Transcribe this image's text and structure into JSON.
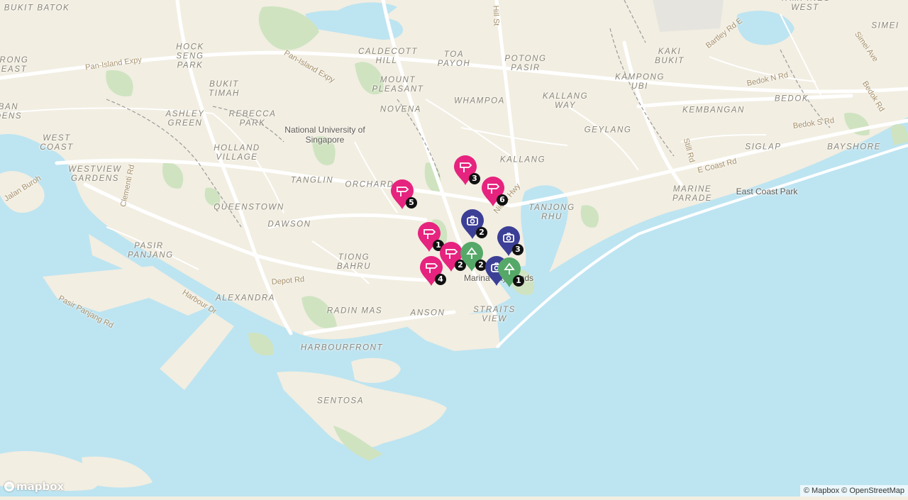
{
  "colors": {
    "water": "#bde4f1",
    "land": "#f2eee2",
    "park": "#cfe3c0",
    "sight": "#e6237e",
    "photo": "#3c3f96",
    "nature": "#55a868"
  },
  "areas": [
    "BUKIT BATOK",
    "HOCK SENG PARK",
    "CALDECOTT HILL",
    "TOA PAYOH",
    "POTONG PASIR",
    "KAKI BUKIT",
    "TAMPINES WEST",
    "SIMEI",
    "BUKIT TIMAH",
    "MOUNT PLEASANT",
    "KAMPONG UBI",
    "RONG EAST",
    "BAN DENS",
    "ASHLEY GREEN",
    "REBECCA PARK",
    "NOVENA",
    "WHAMPOA",
    "KALLANG WAY",
    "GEYLANG",
    "KEMBANGAN",
    "BEDOK",
    "WEST COAST",
    "HOLLAND VILLAGE",
    "WESTVIEW GARDENS",
    "TANGLIN",
    "ORCHARD",
    "KALLANG",
    "SIGLAP",
    "BAYSHORE",
    "MARINE PARADE",
    "QUEENSTOWN",
    "DAWSON",
    "TANJONG RHU",
    "PASIR PANJANG",
    "TIONG BAHRU",
    "ALEXANDRA",
    "RADIN MAS",
    "ANSON",
    "STRAITS VIEW",
    "HARBOURFRONT",
    "SENTOSA"
  ],
  "pois": [
    "National University of Singapore",
    "East Coast Park",
    "Marina Bay Sands"
  ],
  "roads": [
    "Pan-Island Expy",
    "Pan-Island Expy",
    "Bartley Rd E",
    "Bedok N Rd",
    "Bedok Rd",
    "Simei Ave",
    "Bedok S Rd",
    "Still Rd",
    "E Coast Rd",
    "Clementi Rd",
    "Jalan Buroh",
    "Nicoll Hwy",
    "Depot Rd",
    "Harbour Dr",
    "Pasir Panjang Rd",
    "Hill St"
  ],
  "markers": [
    {
      "category": "sight",
      "label": "5",
      "icon": "signpost-icon"
    },
    {
      "category": "sight",
      "label": "3",
      "icon": "signpost-icon"
    },
    {
      "category": "sight",
      "label": "6",
      "icon": "signpost-icon"
    },
    {
      "category": "photo",
      "label": "2",
      "icon": "camera-icon"
    },
    {
      "category": "sight",
      "label": "1",
      "icon": "signpost-icon"
    },
    {
      "category": "photo",
      "label": "3",
      "icon": "camera-icon"
    },
    {
      "category": "sight",
      "label": "2",
      "icon": "signpost-icon"
    },
    {
      "category": "nature",
      "label": "2",
      "icon": "tree-icon"
    },
    {
      "category": "sight",
      "label": "4",
      "icon": "signpost-icon"
    },
    {
      "category": "photo",
      "label": "",
      "icon": "camera-icon"
    },
    {
      "category": "nature",
      "label": "1",
      "icon": "tree-icon"
    }
  ],
  "attribution": {
    "mapbox": "© Mapbox",
    "osm": "© OpenStreetMap"
  },
  "logo_text": "mapbox"
}
